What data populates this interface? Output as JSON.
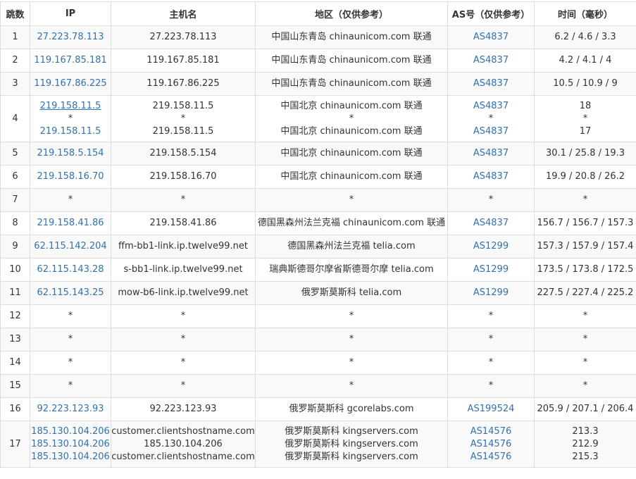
{
  "header": {
    "hop": "跳数",
    "ip": "IP",
    "host": "主机名",
    "location": "地区（仅供参考）",
    "asn": "AS号（仅供参考）",
    "time": "时间（毫秒）"
  },
  "rows": [
    {
      "hop": "1",
      "ip": [
        "27.223.78.113"
      ],
      "host": [
        "27.223.78.113"
      ],
      "loc": [
        "中国山东青岛 chinaunicom.com 联通"
      ],
      "asn": [
        "AS4837"
      ],
      "time": [
        "6.2 / 4.6 / 3.3"
      ]
    },
    {
      "hop": "2",
      "ip": [
        "119.167.85.181"
      ],
      "host": [
        "119.167.85.181"
      ],
      "loc": [
        "中国山东青岛 chinaunicom.com 联通"
      ],
      "asn": [
        "AS4837"
      ],
      "time": [
        "4.2 / 4.1 / 4"
      ]
    },
    {
      "hop": "3",
      "ip": [
        "119.167.86.225"
      ],
      "host": [
        "119.167.86.225"
      ],
      "loc": [
        "中国山东青岛 chinaunicom.com 联通"
      ],
      "asn": [
        "AS4837"
      ],
      "time": [
        "10.5 / 10.9 / 9"
      ]
    },
    {
      "hop": "4",
      "ip": [
        "219.158.11.5",
        "*",
        "219.158.11.5"
      ],
      "host": [
        "219.158.11.5",
        "*",
        "219.158.11.5"
      ],
      "loc": [
        "中国北京 chinaunicom.com 联通",
        "*",
        "中国北京 chinaunicom.com 联通"
      ],
      "asn": [
        "AS4837",
        "*",
        "AS4837"
      ],
      "time": [
        "18",
        "*",
        "17"
      ]
    },
    {
      "hop": "5",
      "ip": [
        "219.158.5.154"
      ],
      "host": [
        "219.158.5.154"
      ],
      "loc": [
        "中国北京 chinaunicom.com 联通"
      ],
      "asn": [
        "AS4837"
      ],
      "time": [
        "30.1 / 25.8 / 19.3"
      ]
    },
    {
      "hop": "6",
      "ip": [
        "219.158.16.70"
      ],
      "host": [
        "219.158.16.70"
      ],
      "loc": [
        "中国北京 chinaunicom.com 联通"
      ],
      "asn": [
        "AS4837"
      ],
      "time": [
        "19.9 / 20.8 / 26.2"
      ]
    },
    {
      "hop": "7",
      "ip": [
        "*"
      ],
      "host": [
        "*"
      ],
      "loc": [
        "*"
      ],
      "asn": [
        "*"
      ],
      "time": [
        "*"
      ]
    },
    {
      "hop": "8",
      "ip": [
        "219.158.41.86"
      ],
      "host": [
        "219.158.41.86"
      ],
      "loc": [
        "德国黑森州法兰克福 chinaunicom.com 联通"
      ],
      "asn": [
        "AS4837"
      ],
      "time": [
        "156.7 / 156.7 / 157.3"
      ]
    },
    {
      "hop": "9",
      "ip": [
        "62.115.142.204"
      ],
      "host": [
        "ffm-bb1-link.ip.twelve99.net"
      ],
      "loc": [
        "德国黑森州法兰克福 telia.com"
      ],
      "asn": [
        "AS1299"
      ],
      "time": [
        "157.3 / 157.9 / 157.4"
      ]
    },
    {
      "hop": "10",
      "ip": [
        "62.115.143.28"
      ],
      "host": [
        "s-bb1-link.ip.twelve99.net"
      ],
      "loc": [
        "瑞典斯德哥尔摩省斯德哥尔摩 telia.com"
      ],
      "asn": [
        "AS1299"
      ],
      "time": [
        "173.5 / 173.8 / 172.5"
      ]
    },
    {
      "hop": "11",
      "ip": [
        "62.115.143.25"
      ],
      "host": [
        "mow-b6-link.ip.twelve99.net"
      ],
      "loc": [
        "俄罗斯莫斯科 telia.com"
      ],
      "asn": [
        "AS1299"
      ],
      "time": [
        "227.5 / 227.4 / 225.2"
      ]
    },
    {
      "hop": "12",
      "ip": [
        "*"
      ],
      "host": [
        "*"
      ],
      "loc": [
        "*"
      ],
      "asn": [
        "*"
      ],
      "time": [
        "*"
      ]
    },
    {
      "hop": "13",
      "ip": [
        "*"
      ],
      "host": [
        "*"
      ],
      "loc": [
        "*"
      ],
      "asn": [
        "*"
      ],
      "time": [
        "*"
      ]
    },
    {
      "hop": "14",
      "ip": [
        "*"
      ],
      "host": [
        "*"
      ],
      "loc": [
        "*"
      ],
      "asn": [
        "*"
      ],
      "time": [
        "*"
      ]
    },
    {
      "hop": "15",
      "ip": [
        "*"
      ],
      "host": [
        "*"
      ],
      "loc": [
        "*"
      ],
      "asn": [
        "*"
      ],
      "time": [
        "*"
      ]
    },
    {
      "hop": "16",
      "ip": [
        "92.223.123.93"
      ],
      "host": [
        "92.223.123.93"
      ],
      "loc": [
        "俄罗斯莫斯科 gcorelabs.com"
      ],
      "asn": [
        "AS199524"
      ],
      "time": [
        "205.9 / 207.1 / 206.4"
      ]
    },
    {
      "hop": "17",
      "ip": [
        "185.130.104.206",
        "185.130.104.206",
        "185.130.104.206"
      ],
      "host": [
        "customer.clientshostname.com",
        "185.130.104.206",
        "customer.clientshostname.com"
      ],
      "loc": [
        "俄罗斯莫斯科 kingservers.com",
        "俄罗斯莫斯科 kingservers.com",
        "俄罗斯莫斯科 kingservers.com"
      ],
      "asn": [
        "AS14576",
        "AS14576",
        "AS14576"
      ],
      "time": [
        "213.3",
        "212.9",
        "215.3"
      ]
    }
  ],
  "colors": {
    "link": "#3072b3",
    "border": "#dddddd",
    "stripe": "#f9f9f9"
  }
}
